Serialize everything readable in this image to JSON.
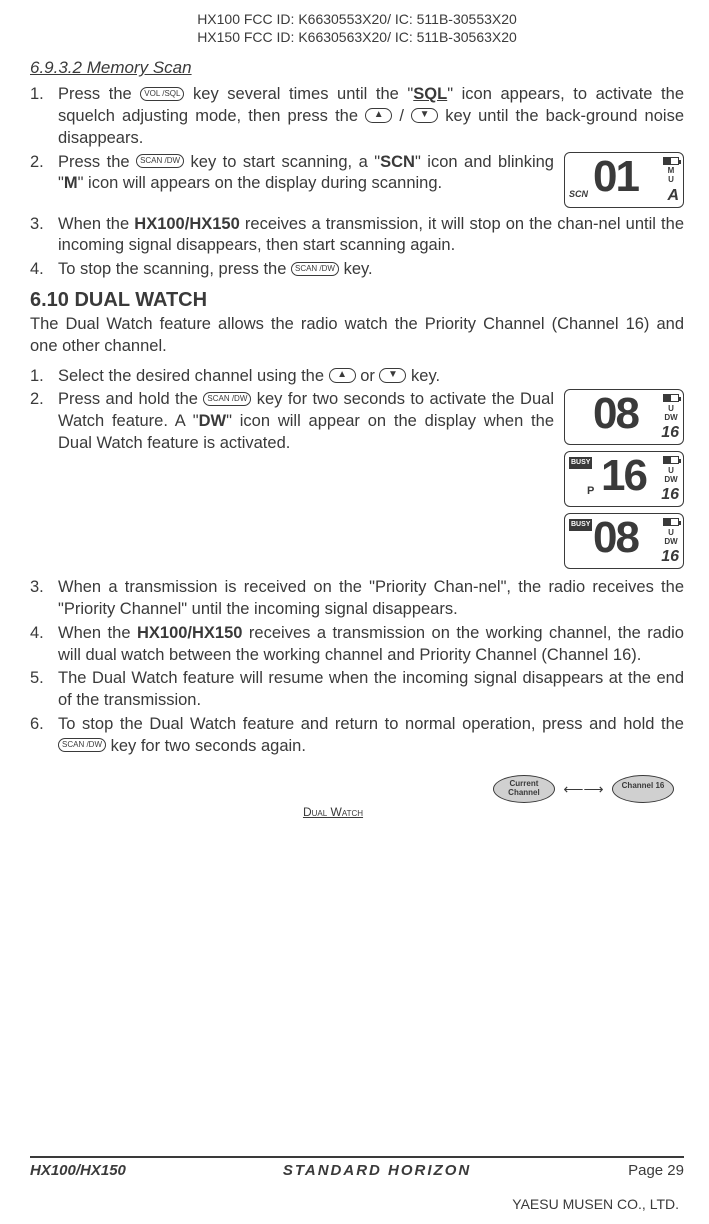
{
  "header": {
    "line1": "HX100 FCC ID: K6630553X20/ IC: 511B-30553X20",
    "line2": "HX150 FCC ID: K6630563X20/ IC: 511B-30563X20"
  },
  "section_6932": {
    "title": "6.9.3.2 Memory Scan",
    "steps": [
      {
        "num": "1.",
        "pre": "Press the ",
        "key": "VOL /SQL",
        "mid1": " key several times until the \"",
        "sql": "SQL",
        "mid2": "\" icon appears, to activate the squelch adjusting mode, then press the ",
        "up": "▲",
        "slash": " / ",
        "down": "▼",
        "tail": " key until the back-ground noise  disappears."
      },
      {
        "num": "2.",
        "pre": "Press the ",
        "key": "SCAN /DW",
        "mid1": " key to start scanning, a \"",
        "scn": "SCN",
        "mid2": "\" icon and blinking \"",
        "m": "M",
        "tail": "\" icon will appears on the display during scanning."
      },
      {
        "num": "3.",
        "pre": "When the ",
        "model": "HX100/HX150",
        "tail": " receives a transmission, it will stop on the chan-nel until the incoming signal disappears, then start scanning again."
      },
      {
        "num": "4.",
        "pre": "To stop the scanning, press the ",
        "key": "SCAN /DW",
        "tail": " key."
      }
    ],
    "lcd": {
      "digits": "01",
      "scn": "SCN",
      "m": "M",
      "u": "U",
      "a": "A"
    }
  },
  "section_610": {
    "title": "6.10 DUAL WATCH",
    "intro": "The Dual Watch feature allows the radio watch the Priority Channel (Channel 16) and one other channel.",
    "steps": [
      {
        "num": "1.",
        "pre": "Select the desired channel using the ",
        "up": "▲",
        "or": " or ",
        "down": "▼",
        "tail": " key."
      },
      {
        "num": "2.",
        "pre": "Press and hold the ",
        "key": "SCAN /DW",
        "mid1": " key for two seconds to activate the Dual Watch feature. A \"",
        "dw": "DW",
        "tail": "\" icon will appear on the display when the Dual Watch feature is activated."
      },
      {
        "num": "3.",
        "text": "When a transmission is received on the \"Priority Chan-nel\", the radio receives the \"Priority Channel\" until the incoming signal disappears."
      },
      {
        "num": "4.",
        "pre": "When the ",
        "model": "HX100/HX150",
        "tail": " receives a transmission on the working channel, the radio will dual watch between the working channel and Priority Channel (Channel 16)."
      },
      {
        "num": "5.",
        "text": "The Dual Watch feature will resume when the incoming signal disappears at the end of the transmission."
      },
      {
        "num": "6.",
        "pre": "To stop the Dual Watch feature and return to normal operation, press and hold the ",
        "key": "SCAN /DW",
        "tail": " key for two seconds again."
      }
    ],
    "lcd1": {
      "digits": "08",
      "u": "U",
      "dw": "DW",
      "sub": "16"
    },
    "lcd2": {
      "busy": "BUSY",
      "p": "P",
      "digits": "16",
      "u": "U",
      "dw": "DW",
      "sub": "16"
    },
    "lcd3": {
      "busy": "BUSY",
      "digits": "08",
      "u": "U",
      "dw": "DW",
      "sub": "16"
    },
    "diagram": {
      "left": "Current Channel",
      "right": "Channel 16",
      "label": "Dual Watch"
    }
  },
  "footer": {
    "model": "HX100/HX150",
    "brand": "STANDARD HORIZON",
    "page": "Page 29",
    "company": "YAESU MUSEN CO., LTD."
  }
}
